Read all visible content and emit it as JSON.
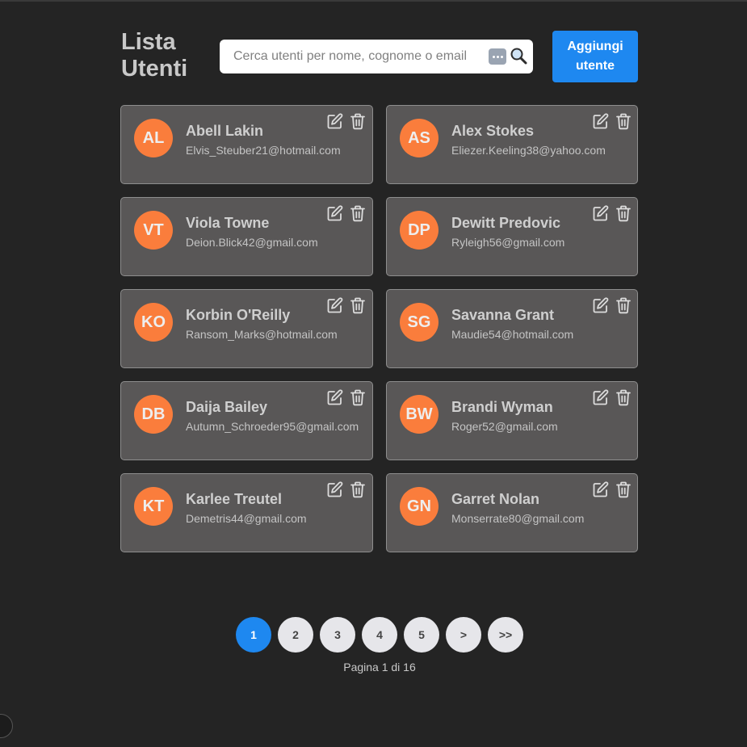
{
  "header": {
    "title": "Lista Utenti",
    "search_placeholder": "Cerca utenti per nome, cognome o email",
    "search_value": "",
    "add_button_label": "Aggiungi utente"
  },
  "colors": {
    "background": "#242424",
    "card": "#595757",
    "avatar": "#fa7d3c",
    "accent": "#1e88f0"
  },
  "icons": [
    "password-manager-icon",
    "search-icon",
    "edit-icon",
    "trash-icon"
  ],
  "users": [
    {
      "initials": "AL",
      "name": "Abell Lakin",
      "email": "Elvis_Steuber21@hotmail.com"
    },
    {
      "initials": "AS",
      "name": "Alex Stokes",
      "email": "Eliezer.Keeling38@yahoo.com"
    },
    {
      "initials": "VT",
      "name": "Viola Towne",
      "email": "Deion.Blick42@gmail.com"
    },
    {
      "initials": "DP",
      "name": "Dewitt Predovic",
      "email": "Ryleigh56@gmail.com"
    },
    {
      "initials": "KO",
      "name": "Korbin O'Reilly",
      "email": "Ransom_Marks@hotmail.com"
    },
    {
      "initials": "SG",
      "name": "Savanna Grant",
      "email": "Maudie54@hotmail.com"
    },
    {
      "initials": "DB",
      "name": "Daija Bailey",
      "email": "Autumn_Schroeder95@gmail.com"
    },
    {
      "initials": "BW",
      "name": "Brandi Wyman",
      "email": "Roger52@gmail.com"
    },
    {
      "initials": "KT",
      "name": "Karlee Treutel",
      "email": "Demetris44@gmail.com"
    },
    {
      "initials": "GN",
      "name": "Garret Nolan",
      "email": "Monserrate80@gmail.com"
    }
  ],
  "pagination": {
    "pages": [
      "1",
      "2",
      "3",
      "4",
      "5"
    ],
    "current": "1",
    "next_label": ">",
    "last_label": ">>",
    "info": "Pagina 1 di 16"
  }
}
